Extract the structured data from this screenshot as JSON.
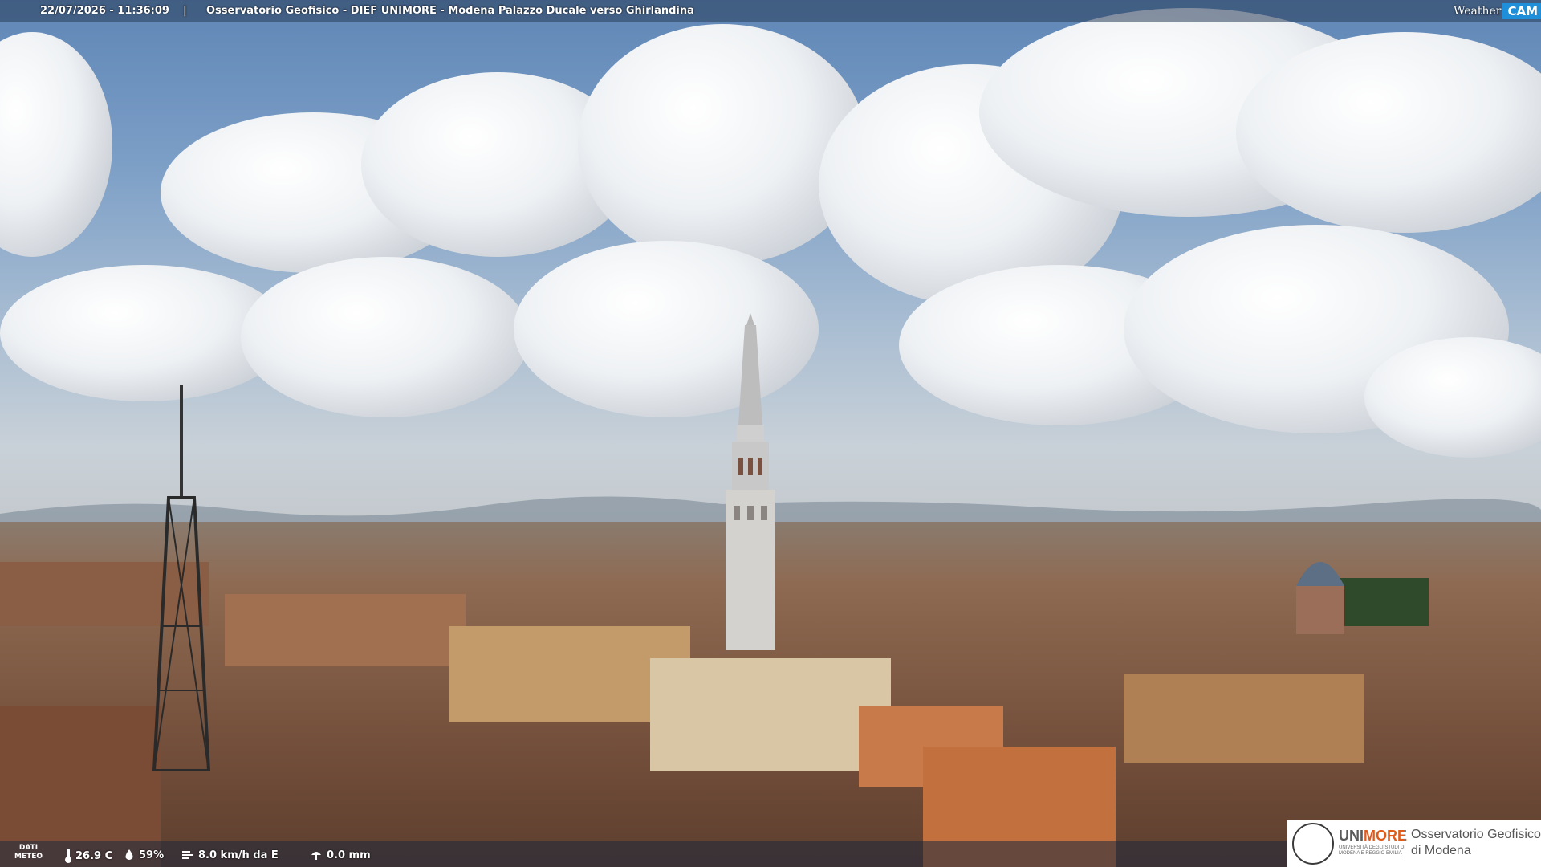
{
  "header": {
    "datetime": "22/07/2026 - 11:36:09",
    "separator": "|",
    "title": "Osservatorio Geofisico - DIEF UNIMORE - Modena Palazzo Ducale verso Ghirlandina"
  },
  "logo": {
    "weather": "Weather",
    "cam": "CAM"
  },
  "weather_bar": {
    "label_line1": "DATI",
    "label_line2": "METEO",
    "temperature": "26.9 C",
    "humidity": "59%",
    "wind": "8.0 km/h da E",
    "rain": "0.0 mm",
    "icons": [
      "thermometer-icon",
      "humidity-drop-icon",
      "wind-icon",
      "rain-icon"
    ]
  },
  "unimore_badge": {
    "brand_prefix": "UNI",
    "brand_suffix": "MORE",
    "brand_sub": "UNIVERSITÀ DEGLI STUDI DI MODENA E REGGIO EMILIA",
    "observatory_line1": "Osservatorio Geofisico",
    "observatory_line2": "di Modena",
    "accent_color": "#e05a1a"
  },
  "colors": {
    "topbar": "#283c5a",
    "webcam_accent": "#1e8fd8"
  }
}
